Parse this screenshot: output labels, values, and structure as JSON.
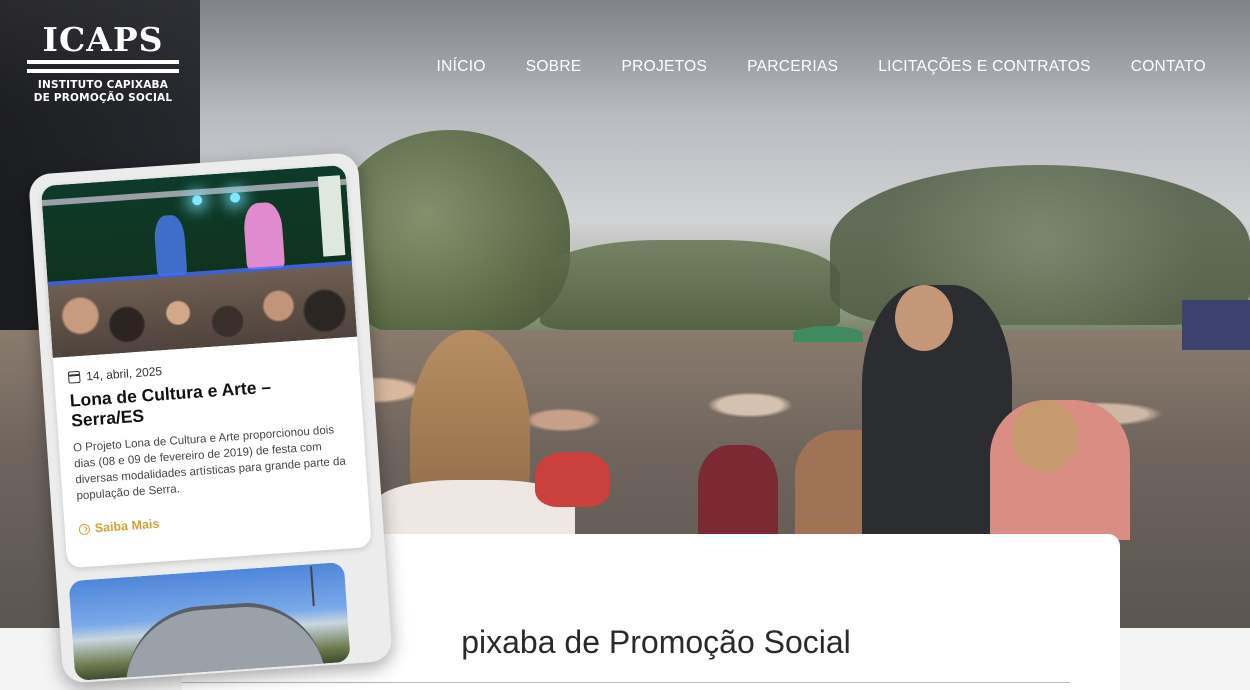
{
  "logo": {
    "word": "ICAPS",
    "subtitle_line1": "INSTITUTO CAPIXABA",
    "subtitle_line2": "DE PROMOÇÃO SOCIAL"
  },
  "nav": {
    "items": [
      "INÍCIO",
      "SOBRE",
      "PROJETOS",
      "PARCERIAS",
      "LICITAÇÕES E CONTRATOS",
      "CONTATO"
    ]
  },
  "content": {
    "title_visible": "pixaba de Promoção Social"
  },
  "post": {
    "date": "14, abril, 2025",
    "title": "Lona de Cultura e Arte – Serra/ES",
    "excerpt": "O Projeto Lona de Cultura e Arte proporcionou dois dias (08 e 09 de fevereiro de 2019) de festa com diversas modalidades artísticas para grande parte da população de Serra.",
    "more_label": "Saiba Mais"
  },
  "colors": {
    "accent": "#d1a233",
    "white": "#ffffff",
    "dark": "#1a1b1e"
  },
  "icons": {
    "calendar": "calendar-icon",
    "more": "arrow-circle-icon"
  }
}
